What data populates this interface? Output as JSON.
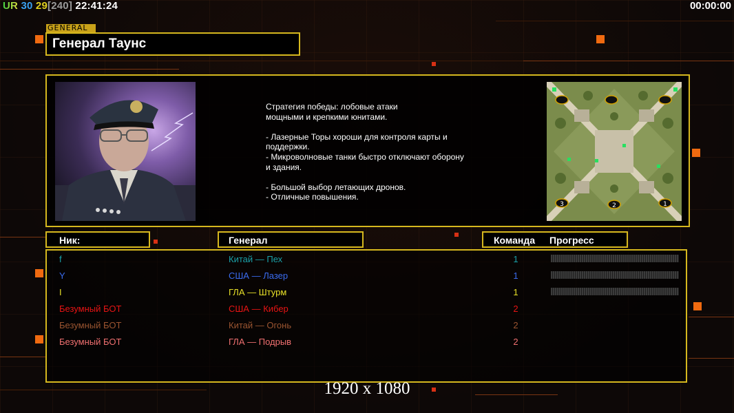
{
  "status": {
    "prefix": "UR",
    "num1": "30",
    "num2": "29",
    "bracket": "[240]",
    "clock": "22:41:24",
    "timer": "00:00:00"
  },
  "general": {
    "tag": "GENERAL",
    "name": "Генерал Таунс",
    "description": "Стратегия победы: лобовые атаки\nмощными и крепкими юнитами.\n\n- Лазерные Торы хороши для контроля карты и\n  поддержки.\n- Микроволновые танки быстро отключают оборону\n  и здания.\n\n- Большой выбор летающих дронов.\n- Отличные повышения."
  },
  "table": {
    "col_nick": "Ник:",
    "col_general": "Генерал",
    "col_team": "Команда",
    "col_progress": "Прогресс",
    "players": [
      {
        "nick": "f",
        "general": "Китай — Пех",
        "team": "1",
        "color": "#1aa0a8",
        "progress": true
      },
      {
        "nick": "Y",
        "general": "США — Лазер",
        "team": "1",
        "color": "#3a6cf0",
        "progress": true
      },
      {
        "nick": "I",
        "general": "ГЛА — Штурм",
        "team": "1",
        "color": "#e8e028",
        "progress": true
      },
      {
        "nick": "Безумный БОТ",
        "general": "США — Кибер",
        "team": "2",
        "color": "#e81414",
        "progress": false
      },
      {
        "nick": "Безумный БОТ",
        "general": "Китай — Огонь",
        "team": "2",
        "color": "#9a5430",
        "progress": false
      },
      {
        "nick": "Безумный БОТ",
        "general": "ГЛА — Подрыв",
        "team": "2",
        "color": "#f07070",
        "progress": false
      }
    ]
  },
  "minimap": {
    "start_labels": [
      "3",
      "2",
      "1"
    ]
  },
  "resolution": "1920 x 1080",
  "colors": {
    "accent": "#d6b81e",
    "orange": "#f06a10"
  }
}
